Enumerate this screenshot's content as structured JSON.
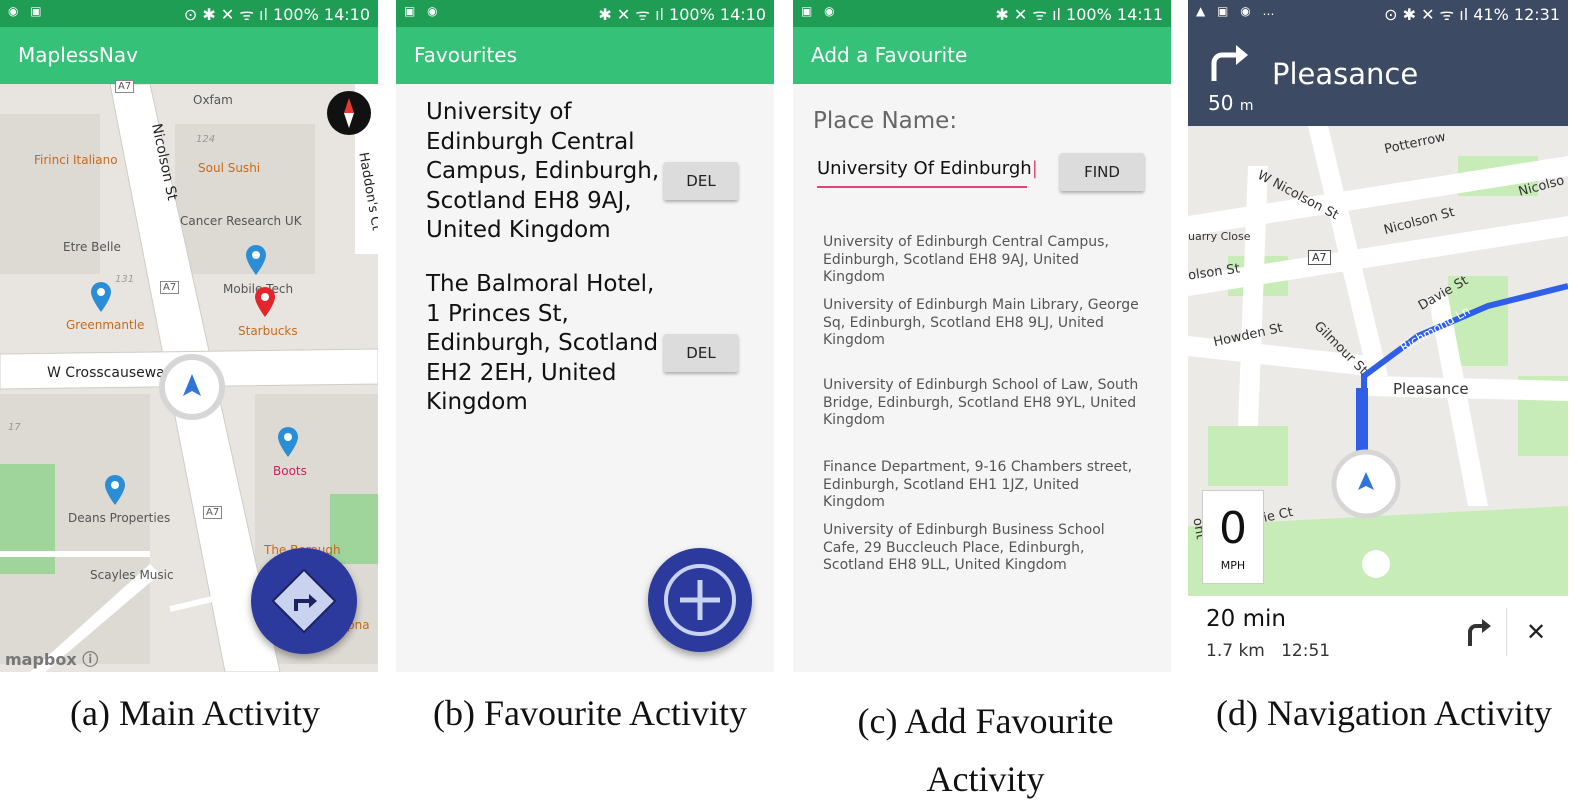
{
  "panel_a": {
    "status_time": "14:10",
    "status_battery": "100%",
    "app_title": "MaplessNav",
    "map_labels": {
      "oxfam": "Oxfam",
      "firinci": "Firinci Italiano",
      "soul_sushi": "Soul Sushi",
      "cancer_research": "Cancer Research UK",
      "etre_belle": "Etre Belle",
      "greenmantle": "Greenmantle",
      "mobile_tech": "Mobile Tech",
      "starbucks": "Starbucks",
      "boots": "Boots",
      "deans": "Deans Properties",
      "scayles": "Scayles Music",
      "the_borough": "The Borough",
      "pna": "pna",
      "nicolson_st": "Nicolson St",
      "haddons_ct": "Haddon's Ct",
      "w_crosscauseway": "W Crosscauseway",
      "a7_top": "A7",
      "a7_mid": "A7",
      "a7_low": "A7",
      "n124": "124",
      "n131": "131",
      "n17": "17"
    },
    "mapbox_label": "mapbox",
    "caption": "(a)  Main Activity"
  },
  "panel_b": {
    "status_time": "14:10",
    "status_battery": "100%",
    "app_title": "Favourites",
    "favourites": [
      {
        "text": "University of Edinburgh Central Campus, Edinburgh, Scotland EH8 9AJ, United Kingdom",
        "button": "DEL"
      },
      {
        "text": "The Balmoral Hotel, 1 Princes St, Edinburgh, Scotland EH2 2EH, United Kingdom",
        "button": "DEL"
      }
    ],
    "caption": "(b)  Favourite Activity"
  },
  "panel_c": {
    "status_time": "14:11",
    "status_battery": "100%",
    "app_title": "Add a Favourite",
    "place_label": "Place Name:",
    "place_value": "University Of Edinburgh",
    "find_button": "FIND",
    "results": [
      "University of Edinburgh Central Campus, Edinburgh, Scotland EH8 9AJ, United Kingdom",
      "University of Edinburgh Main Library, George Sq, Edinburgh, Scotland EH8 9LJ, United Kingdom",
      "University of Edinburgh School of Law, South Bridge, Edinburgh, Scotland EH8 9YL, United Kingdom",
      "Finance Department, 9-16 Chambers street, Edinburgh, Scotland EH1 1JZ, United Kingdom",
      "University of Edinburgh Business School Cafe, 29 Buccleuch Place, Edinburgh, Scotland EH8 9LL, United Kingdom"
    ],
    "caption_line1": "(c)  Add Favourite",
    "caption_line2": "Activity"
  },
  "panel_d": {
    "status_time": "12:31",
    "status_battery": "41%",
    "instruction_distance": "50",
    "instruction_unit": "m",
    "instruction_street": "Pleasance",
    "map_labels": {
      "potterrow": "Potterrow",
      "w_nicolson": "W Nicolson St",
      "nicolson_st": "Nicolson St",
      "nicolson_right": "Nicolso",
      "quarry_close": "uarry Close",
      "olson_st": "olson St",
      "a7": "A7",
      "davie_st": "Davie St",
      "howden_st": "Howden St",
      "gilmour_st": "Gilmour St",
      "richmond_ln": "Richmond Ln",
      "pleasance": "Pleasance",
      "carnegie_ct": "rnegie Ct",
      "ont": "ont"
    },
    "speed_value": "0",
    "speed_unit": "MPH",
    "duration": "20 min",
    "distance": "1.7 km",
    "arrival": "12:51",
    "caption": "(d)  Navigation Activity"
  },
  "icons": {
    "status_left": "notification-icons",
    "status_right": "system-icons",
    "compass": "compass-icon",
    "turn_right": "turn-right-icon",
    "add": "add-icon",
    "close": "close-icon"
  },
  "colors": {
    "app_bar": "#36c178",
    "status_bar": "#1f9d55",
    "fab": "#2b3a9c",
    "route": "#2f5fe6",
    "nav_header": "#3c4a63",
    "input_underline": "#e0457b"
  }
}
